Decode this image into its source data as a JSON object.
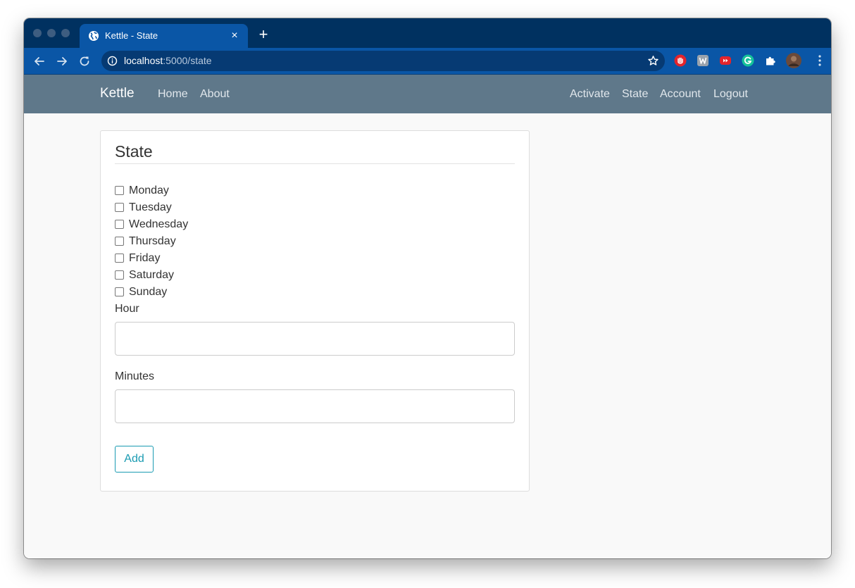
{
  "browser": {
    "tab": {
      "title": "Kettle - State",
      "close_glyph": "×",
      "icon": "globe-icon"
    },
    "new_tab_glyph": "+",
    "address": {
      "host": "localhost",
      "path": ":5000/state",
      "icon": "info-icon"
    },
    "extensions": [
      {
        "icon": "hand-stop-icon",
        "color": "#e3242b"
      },
      {
        "icon": "w-extension-icon",
        "color": "#9aa3ad"
      },
      {
        "icon": "video-extension-icon",
        "color": "#e3242b"
      },
      {
        "icon": "grammarly-icon",
        "color": "#15c39a"
      },
      {
        "icon": "puzzle-icon",
        "color": "#ffffff"
      },
      {
        "icon": "avatar-icon",
        "color": "#6b4a3a"
      }
    ],
    "colors": {
      "tabstrip": "#003160",
      "toolbar": "#0a56a6"
    }
  },
  "navbar": {
    "brand": "Kettle",
    "left_links": [
      "Home",
      "About"
    ],
    "right_links": [
      "Activate",
      "State",
      "Account",
      "Logout"
    ],
    "color": "#5f788a"
  },
  "form": {
    "title": "State",
    "days": [
      {
        "label": "Monday",
        "checked": false
      },
      {
        "label": "Tuesday",
        "checked": false
      },
      {
        "label": "Wednesday",
        "checked": false
      },
      {
        "label": "Thursday",
        "checked": false
      },
      {
        "label": "Friday",
        "checked": false
      },
      {
        "label": "Saturday",
        "checked": false
      },
      {
        "label": "Sunday",
        "checked": false
      }
    ],
    "hour": {
      "label": "Hour",
      "value": ""
    },
    "minutes": {
      "label": "Minutes",
      "value": ""
    },
    "submit_label": "Add",
    "accent": "#1a9bb2"
  }
}
